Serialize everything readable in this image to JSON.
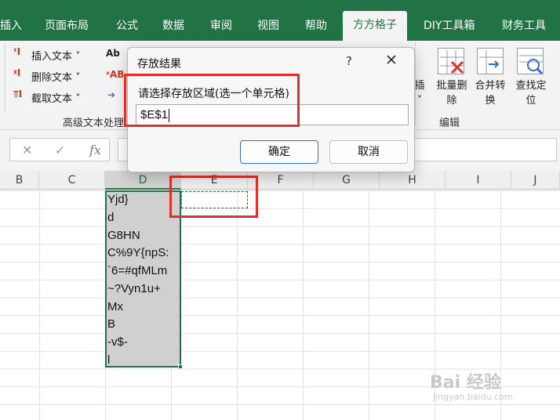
{
  "ribbon_tabs": [
    {
      "label": "插入"
    },
    {
      "label": "页面布局"
    },
    {
      "label": "公式"
    },
    {
      "label": "数据"
    },
    {
      "label": "审阅"
    },
    {
      "label": "视图"
    },
    {
      "label": "帮助"
    },
    {
      "label": "方方格子",
      "active": true
    },
    {
      "label": "DIY工具箱"
    },
    {
      "label": "财务工具"
    }
  ],
  "ribbon": {
    "text_group": {
      "insert_text": "插入文本",
      "delete_text": "删除文本",
      "extract_text": "截取文本",
      "label": "高级文本处理"
    },
    "edit_group": {
      "label": "编辑",
      "btn_batch_delete": "批量删除",
      "btn_merge_convert": "合并转换",
      "btn_find_locate": "查找定位",
      "btn_partial": "插"
    }
  },
  "grid": {
    "columns": [
      "B",
      "C",
      "D",
      "E",
      "F",
      "G",
      "H",
      "I",
      "J"
    ],
    "selected_column": "D",
    "column_d_values": [
      "Yjd}",
      "d",
      "G8HN",
      "C%9Y{npS:",
      "`6=#qfMLm",
      "~?Vyn1u+",
      "Mx",
      "B",
      "-v$-",
      "l"
    ]
  },
  "dialog": {
    "title": "存放结果",
    "help": "?",
    "close": "✕",
    "prompt": "请选择存放区域(选一个单元格)",
    "input_value": "$E$1",
    "ok_label": "确定",
    "cancel_label": "取消"
  },
  "watermark": {
    "main": "Bai 经验",
    "sub": "jingyan.baidu.com"
  },
  "colors": {
    "excel_green": "#217346",
    "highlight_red": "#e0302b",
    "primary_blue": "#2f6fd0"
  }
}
